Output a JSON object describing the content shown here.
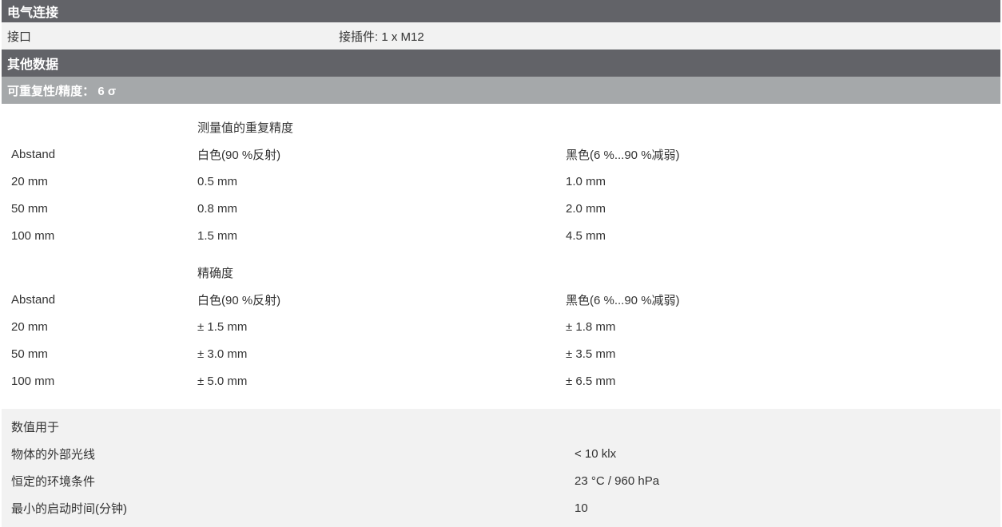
{
  "electrical": {
    "header": "电气连接",
    "interface_label": "接口",
    "interface_value": "接插件: 1 x M12"
  },
  "other": {
    "header": "其他数据",
    "subheader": "可重复性/精度： 6 σ"
  },
  "repeatability": {
    "title": "测量值的重复精度",
    "columns": [
      "Abstand",
      "白色(90 %反射)",
      "黑色(6 %...90 %减弱)"
    ],
    "rows": [
      [
        "20 mm",
        "0.5 mm",
        "1.0 mm"
      ],
      [
        "50 mm",
        "0.8 mm",
        "2.0 mm"
      ],
      [
        "100 mm",
        "1.5 mm",
        "4.5 mm"
      ]
    ]
  },
  "accuracy": {
    "title": "精确度",
    "columns": [
      "Abstand",
      "白色(90 %反射)",
      "黑色(6 %...90 %减弱)"
    ],
    "rows": [
      [
        "20 mm",
        "± 1.5 mm",
        "± 1.8 mm"
      ],
      [
        "50 mm",
        "± 3.0 mm",
        "± 3.5 mm"
      ],
      [
        "100 mm",
        "± 5.0 mm",
        "± 6.5 mm"
      ]
    ]
  },
  "conditions": {
    "title": "数值用于",
    "rows": [
      [
        "物体的外部光线",
        "< 10 klx"
      ],
      [
        "恒定的环境条件",
        "23 °C / 960 hPa"
      ],
      [
        "最小的启动时间(分钟)",
        "10"
      ]
    ]
  }
}
